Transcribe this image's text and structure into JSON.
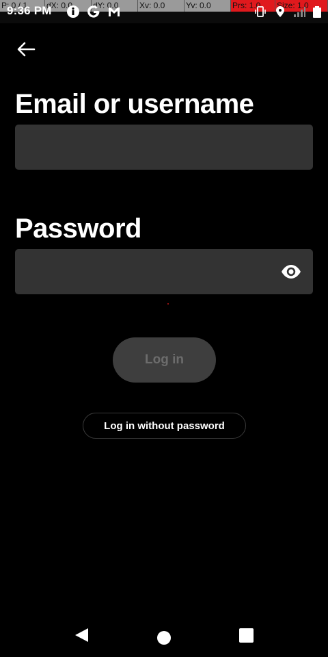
{
  "status_bar": {
    "time": "9:36 PM",
    "debug_cells": [
      "P: 0 / 1",
      "dX: 0.0",
      "dY: 0.0",
      "Xv: 0.0",
      "Yv: 0.0",
      "Prs: 1.0",
      "Size: 1.0"
    ],
    "icons": [
      "info-icon",
      "google-icon",
      "gmail-icon",
      "vibrate-icon",
      "location-icon",
      "signal-icon",
      "battery-icon"
    ]
  },
  "form": {
    "email_label": "Email or username",
    "email_value": "",
    "password_label": "Password",
    "password_value": "",
    "login_label": "Log in",
    "no_password_label": "Log in without password"
  },
  "colors": {
    "background": "#000000",
    "field_bg": "#333333",
    "login_bg": "#3e3e3e",
    "login_text": "#6c6c6c",
    "debug_red": "#e0191d"
  }
}
